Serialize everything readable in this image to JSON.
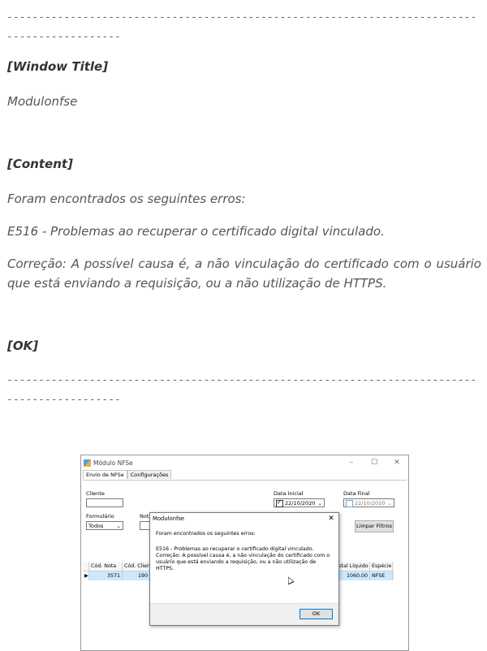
{
  "separator": "--------------------------------------------------------------------------------------------",
  "window_title_label": "[Window Title]",
  "window_title_value": "Modulonfse",
  "content_label": "[Content]",
  "content_line1": "Foram encontrados os seguintes erros:",
  "content_line2": "E516 - Problemas ao recuperar o certificado digital vinculado.",
  "content_line3": "Correção: A possível causa é, a não vinculação do certificado com o usuário que está enviando a requisição, ou a não utilização de HTTPS.",
  "ok_label": "[OK]",
  "screenshot": {
    "title": "Módulo NFSe",
    "window_buttons": {
      "minimize": "–",
      "maximize": "☐",
      "close": "✕"
    },
    "tabs": [
      "Envio de NFSe",
      "Configurações"
    ],
    "cliente_label": "Cliente",
    "formulario_label": "Formulário",
    "formulario_value": "Todos",
    "nota_label": "Nota",
    "data_inicial_label": "Data Inicial",
    "data_inicial_value": "22/10/2020",
    "data_final_label": "Data Final",
    "data_final_value": "22/10/2020",
    "limpar_filtros": "Limpar Filtros",
    "grid_headers": [
      "Cód. Nota",
      "Cód. Client",
      "Total Líquido",
      "Espécie"
    ],
    "grid_row": [
      "3571",
      "190",
      "1060,00",
      "NFSE"
    ],
    "dialog": {
      "title": "Modulonfse",
      "line1": "Foram encontrados os seguintes erros:",
      "line2": "E516 - Problemas ao recuperar o certificado digital vinculado.",
      "line3": "Correção: A possível causa é, a não vinculação do certificado com o usuário que está enviando a requisição, ou a não utilização de HTTPS.",
      "ok": "OK",
      "close": "✕"
    }
  }
}
